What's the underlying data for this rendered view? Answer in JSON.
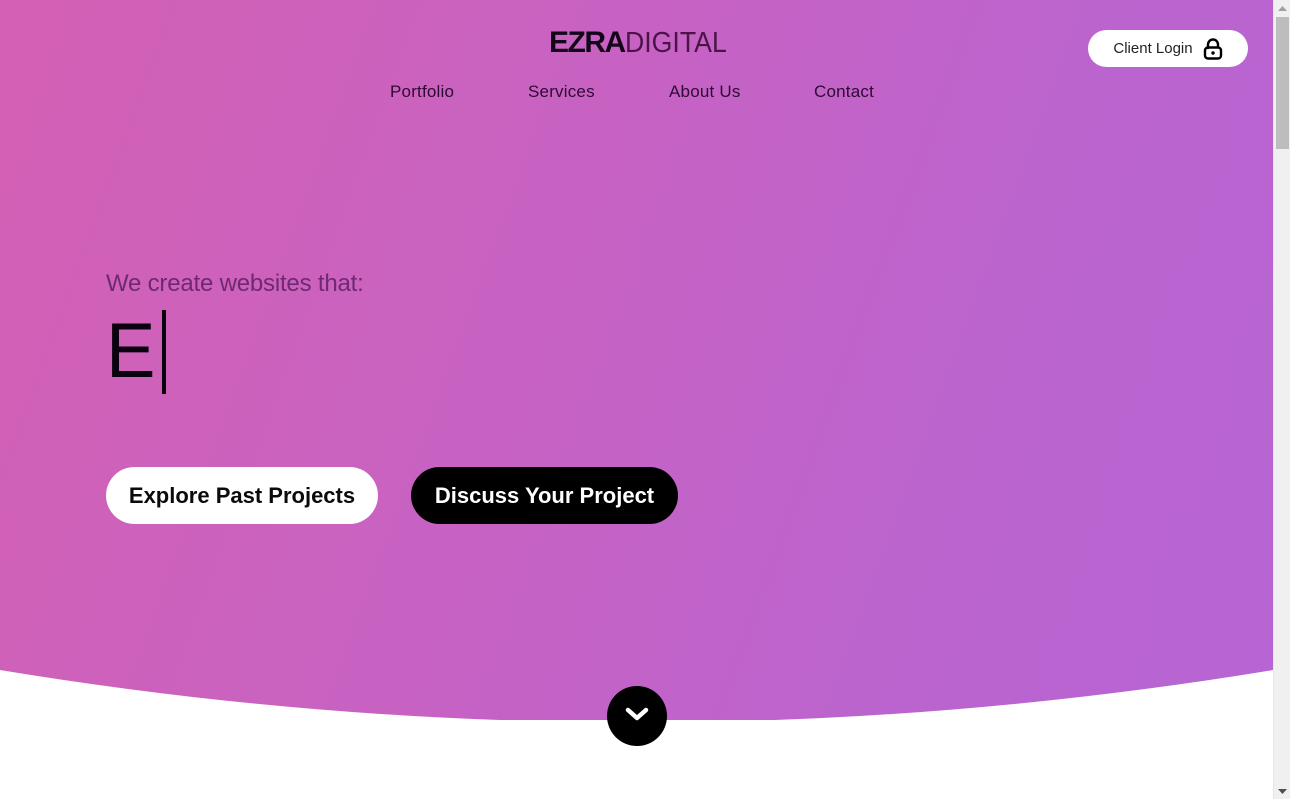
{
  "header": {
    "logo_bold": "EZRA",
    "logo_light": "DIGITAL",
    "nav": [
      {
        "label": "Portfolio"
      },
      {
        "label": "Services"
      },
      {
        "label": "About Us"
      },
      {
        "label": "Contact"
      }
    ],
    "client_login": {
      "label": "Client Login",
      "icon": "lock-icon"
    }
  },
  "hero": {
    "tagline": "We create websites that:",
    "typed_text": "E",
    "buttons": {
      "explore": "Explore Past Projects",
      "discuss": "Discuss Your Project"
    },
    "scroll_icon": "chevron-down-icon"
  },
  "colors": {
    "gradient_start": "#d460b3",
    "gradient_end": "#b765d4",
    "button_dark": "#000000",
    "button_light": "#ffffff"
  },
  "scrollbar": {
    "position_fraction": 0.0
  }
}
